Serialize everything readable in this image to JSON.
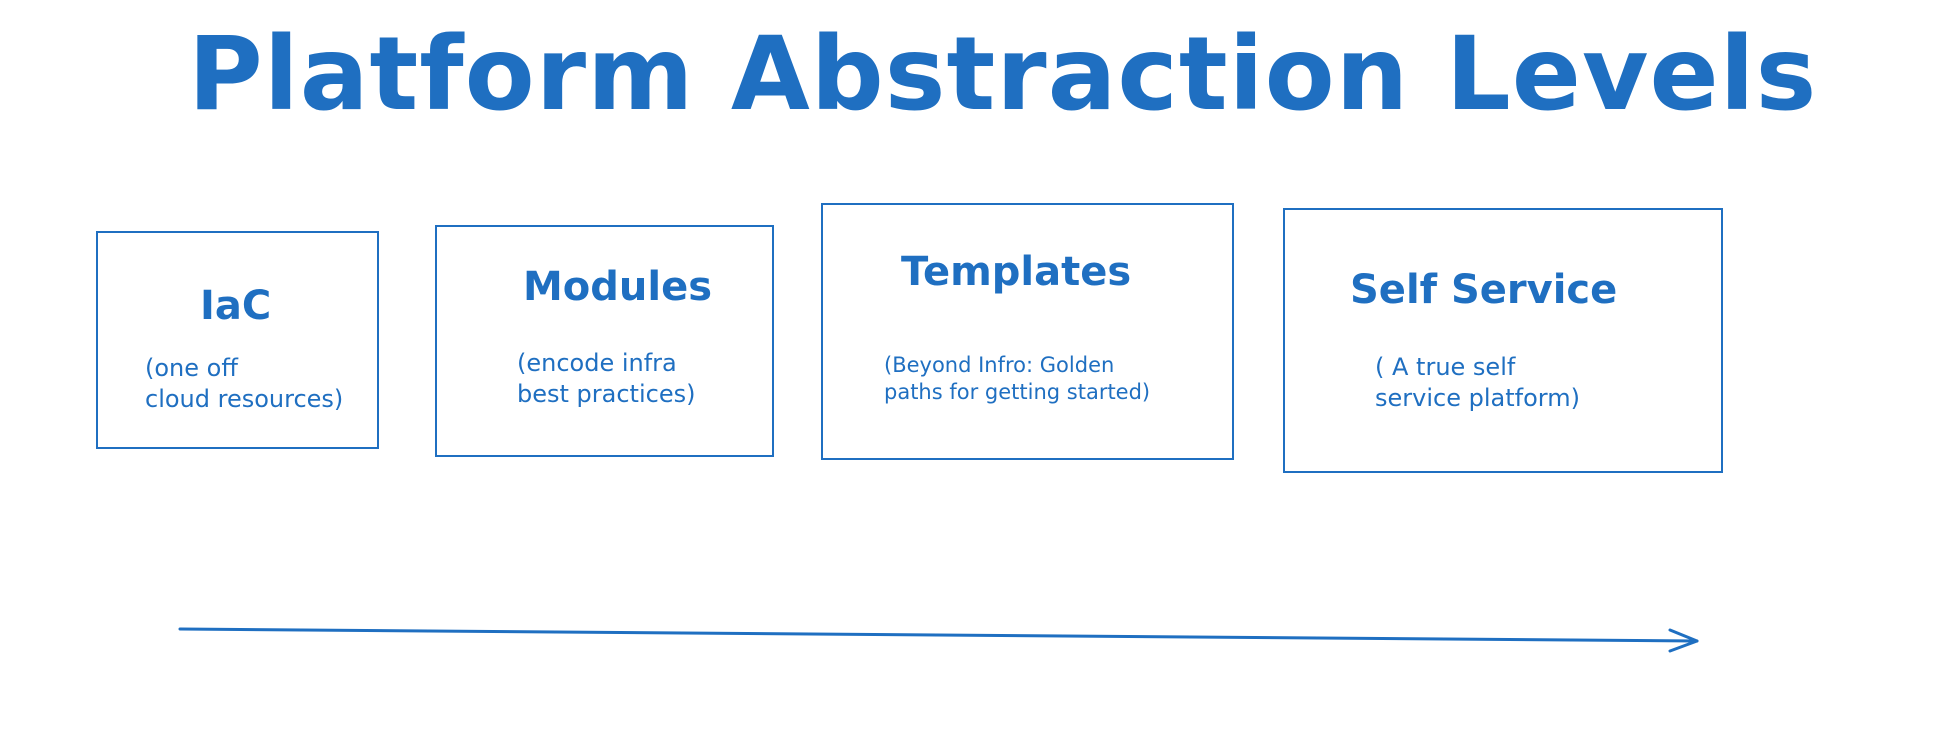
{
  "title": "Platform Abstraction Levels",
  "accent_color": "#1f6fc1",
  "levels": [
    {
      "name": "IaC",
      "description": [
        "(one off",
        "cloud resources)"
      ]
    },
    {
      "name": "Modules",
      "description": [
        "(encode infra",
        "best practices)"
      ]
    },
    {
      "name": "Templates",
      "description": [
        "(Beyond Infro: Golden",
        "paths for getting started)"
      ]
    },
    {
      "name": "Self Service",
      "description": [
        "( A true self",
        "service platform)"
      ]
    }
  ]
}
